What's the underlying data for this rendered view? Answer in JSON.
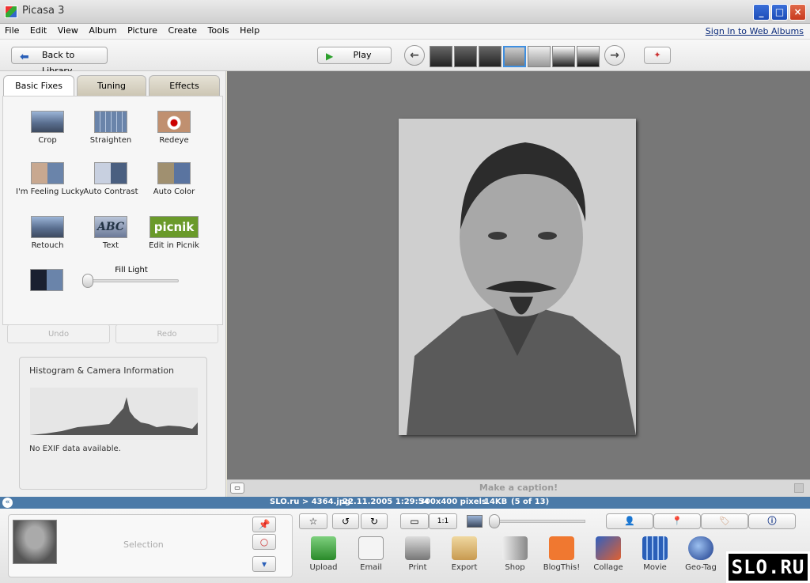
{
  "window": {
    "title": "Picasa 3"
  },
  "menu": {
    "items": [
      "File",
      "Edit",
      "View",
      "Album",
      "Picture",
      "Create",
      "Tools",
      "Help"
    ],
    "signin": "Sign In to Web Albums"
  },
  "toolbar": {
    "back_label": "Back to Library",
    "play_label": "Play"
  },
  "tabs": [
    {
      "label": "Basic Fixes",
      "active": true
    },
    {
      "label": "Tuning",
      "active": false
    },
    {
      "label": "Effects",
      "active": false
    }
  ],
  "basic_fixes": {
    "tools": [
      {
        "label": "Crop",
        "icon": "crop-icon"
      },
      {
        "label": "Straighten",
        "icon": "straighten-icon"
      },
      {
        "label": "Redeye",
        "icon": "redeye-icon"
      },
      {
        "label": "I'm Feeling Lucky",
        "icon": "lucky-icon"
      },
      {
        "label": "Auto Contrast",
        "icon": "auto-contrast-icon"
      },
      {
        "label": "Auto Color",
        "icon": "auto-color-icon"
      },
      {
        "label": "Retouch",
        "icon": "retouch-icon"
      },
      {
        "label": "Text",
        "icon": "text-icon",
        "icon_text": "ABC"
      },
      {
        "label": "Edit in Picnik",
        "icon": "picnik-icon",
        "icon_text": "picnik"
      }
    ],
    "fill_light_label": "Fill Light",
    "fill_light_value": 0
  },
  "undo_label": "Undo",
  "redo_label": "Redo",
  "histogram": {
    "title": "Histogram & Camera Information",
    "exif": "No EXIF data available."
  },
  "caption_placeholder": "Make a caption!",
  "status": {
    "path": "SLO.ru > 4364.jpg",
    "date": "22.11.2005 1:29:54",
    "dimensions": "300x400 pixels",
    "size": "14KB",
    "position": "(5 of 13)"
  },
  "tray": {
    "selection_label": "Selection",
    "ratio_label": "1:1"
  },
  "actions": [
    "Upload",
    "Email",
    "Print",
    "Export",
    "Shop",
    "BlogThis!",
    "Collage",
    "Movie",
    "Geo-Tag"
  ],
  "logo_text": "SLO.RU",
  "colors": {
    "accent": "#4b7aa8",
    "picnik": "#6a9a2a",
    "tab_active": "#ffffff"
  }
}
